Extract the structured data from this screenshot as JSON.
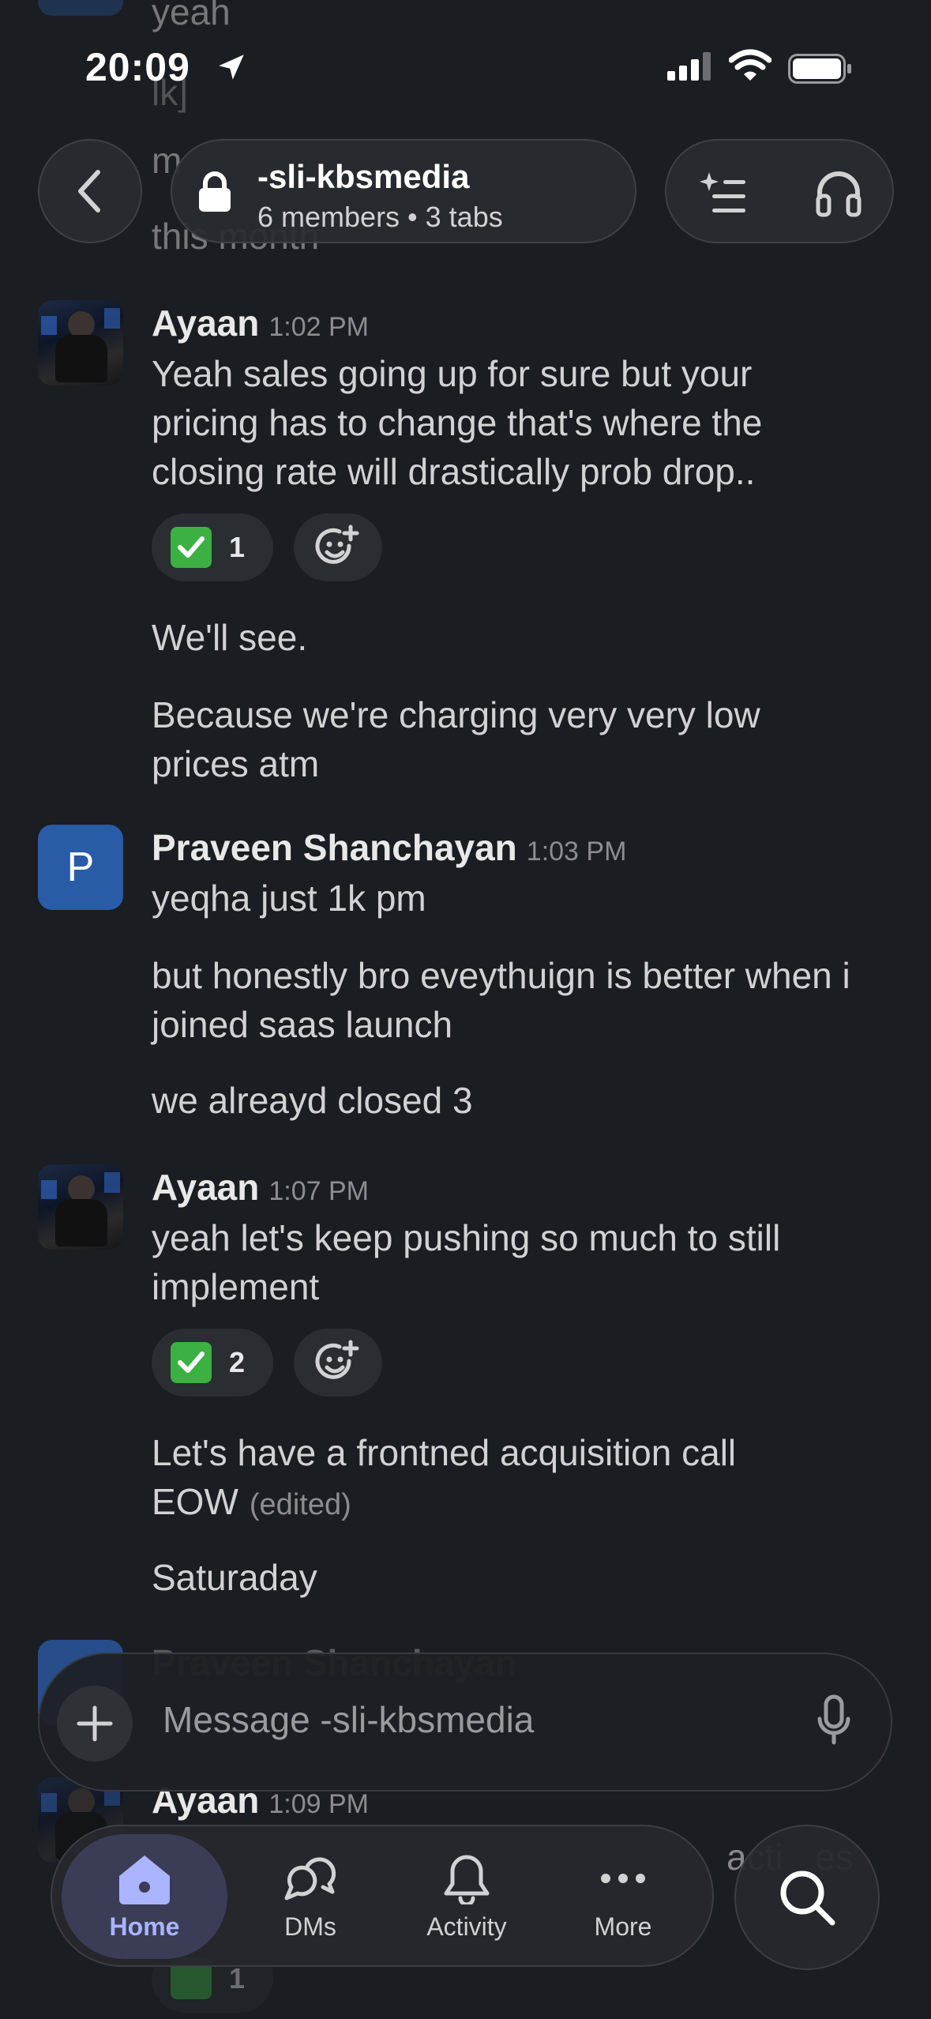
{
  "status": {
    "time": "20:09"
  },
  "header": {
    "channel_name": "-sli-kbsmedia",
    "channel_meta": "6 members • 3 tabs"
  },
  "ghost": {
    "top1": "yeah",
    "top2": "lk]",
    "top3": "m",
    "top4": "this month",
    "bottom_sender": "Praveen Shanchayan",
    "bottom_ayaan_time": "1:09 PM",
    "bottom_text_tail": "acti",
    "bottom_text_tail2": "es",
    "bottom_reaction_count": "1"
  },
  "messages": [
    {
      "sender": "Ayaan",
      "time": "1:02 PM",
      "lines": [
        "Yeah sales going up for sure but your pricing has to change that's where the closing rate will drastically prob drop..",
        "We'll see.",
        "Because we're charging very very low prices atm"
      ],
      "reaction_count": "1"
    },
    {
      "sender": "Praveen Shanchayan",
      "avatar_letter": "P",
      "time": "1:03 PM",
      "lines": [
        "yeqha just 1k pm",
        "but honestly bro eveythuign is better when i joined saas launch",
        "we alreayd closed 3"
      ]
    },
    {
      "sender": "Ayaan",
      "time": "1:07 PM",
      "lines": [
        "yeah let's keep pushing so much to still implement",
        "Let's have a frontned acquisition call EOW",
        "Saturaday"
      ],
      "edited": "(edited)",
      "reaction_count": "2"
    },
    {
      "sender": "Ayaan",
      "time": "1:09 PM"
    }
  ],
  "composer": {
    "placeholder": "Message -sli-kbsmedia"
  },
  "tabs": [
    {
      "label": "Home",
      "icon": "home-icon",
      "active": true
    },
    {
      "label": "DMs",
      "icon": "dms-icon"
    },
    {
      "label": "Activity",
      "icon": "bell-icon"
    },
    {
      "label": "More",
      "icon": "more-icon"
    }
  ],
  "colors": {
    "background": "#1a1d21",
    "accent": "#aab4ff",
    "avatar_blue": "#2a5ba6"
  }
}
